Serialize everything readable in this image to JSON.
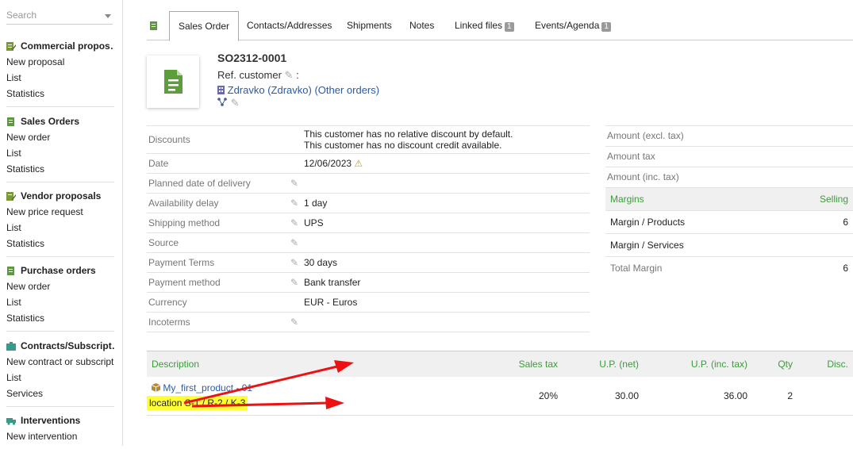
{
  "sidebar": {
    "search_placeholder": "Search",
    "sections": [
      {
        "title": "Commercial propos…",
        "items": [
          "New proposal",
          "List",
          "Statistics"
        ]
      },
      {
        "title": "Sales Orders",
        "items": [
          "New order",
          "List",
          "Statistics"
        ]
      },
      {
        "title": "Vendor proposals",
        "items": [
          "New price request",
          "List",
          "Statistics"
        ]
      },
      {
        "title": "Purchase orders",
        "items": [
          "New order",
          "List",
          "Statistics"
        ]
      },
      {
        "title": "Contracts/Subscript…",
        "items": [
          "New contract or subscript…",
          "List",
          "Services"
        ]
      },
      {
        "title": "Interventions",
        "items": [
          "New intervention"
        ]
      }
    ]
  },
  "tabs": [
    {
      "label": "Sales Order"
    },
    {
      "label": "Contacts/Addresses"
    },
    {
      "label": "Shipments"
    },
    {
      "label": "Notes"
    },
    {
      "label": "Linked files",
      "badge": "1"
    },
    {
      "label": "Events/Agenda",
      "badge": "1"
    }
  ],
  "order": {
    "ref": "SO2312-0001",
    "ref_customer_label": "Ref. customer",
    "ref_customer_sep": ":",
    "thirdparty": "Zdravko (Zdravko)",
    "other_orders": "(Other orders)"
  },
  "fields": [
    {
      "label": "Discounts",
      "value": "This customer has no relative discount by default.",
      "value2": "This customer has no discount credit available."
    },
    {
      "label": "Date",
      "value": "12/06/2023"
    },
    {
      "label": "Planned date of delivery",
      "value": ""
    },
    {
      "label": "Availability delay",
      "value": "1 day"
    },
    {
      "label": "Shipping method",
      "value": "UPS"
    },
    {
      "label": "Source",
      "value": ""
    },
    {
      "label": "Payment Terms",
      "value": "30 days"
    },
    {
      "label": "Payment method",
      "value": "Bank transfer"
    },
    {
      "label": "Currency",
      "value": "EUR - Euros"
    },
    {
      "label": "Incoterms",
      "value": ""
    }
  ],
  "amounts": {
    "excl_label": "Amount (excl. tax)",
    "tax_label": "Amount tax",
    "inc_label": "Amount (inc. tax)"
  },
  "margins": {
    "header": "Margins",
    "header_selling": "Selling",
    "rows": [
      {
        "label": "Margin / Products",
        "value": "6"
      },
      {
        "label": "Margin / Services",
        "value": ""
      },
      {
        "label": "Total Margin",
        "value": "6"
      }
    ]
  },
  "lines": {
    "headers": {
      "description": "Description",
      "vat": "Sales tax",
      "up_net": "U.P. (net)",
      "up_inc": "U.P. (inc. tax)",
      "qty": "Qty",
      "disc": "Disc."
    },
    "rows": [
      {
        "product": "My_first_product - 01",
        "note": "location S-1 / R-2 / K-3",
        "vat": "20%",
        "up_net": "30.00",
        "up_inc": "36.00",
        "qty": "2"
      }
    ]
  },
  "colors": {
    "accent": "#3c9c3c",
    "ref": "#2a7f7a",
    "arrow": "#ee1111",
    "highlight": "#ffff33"
  }
}
